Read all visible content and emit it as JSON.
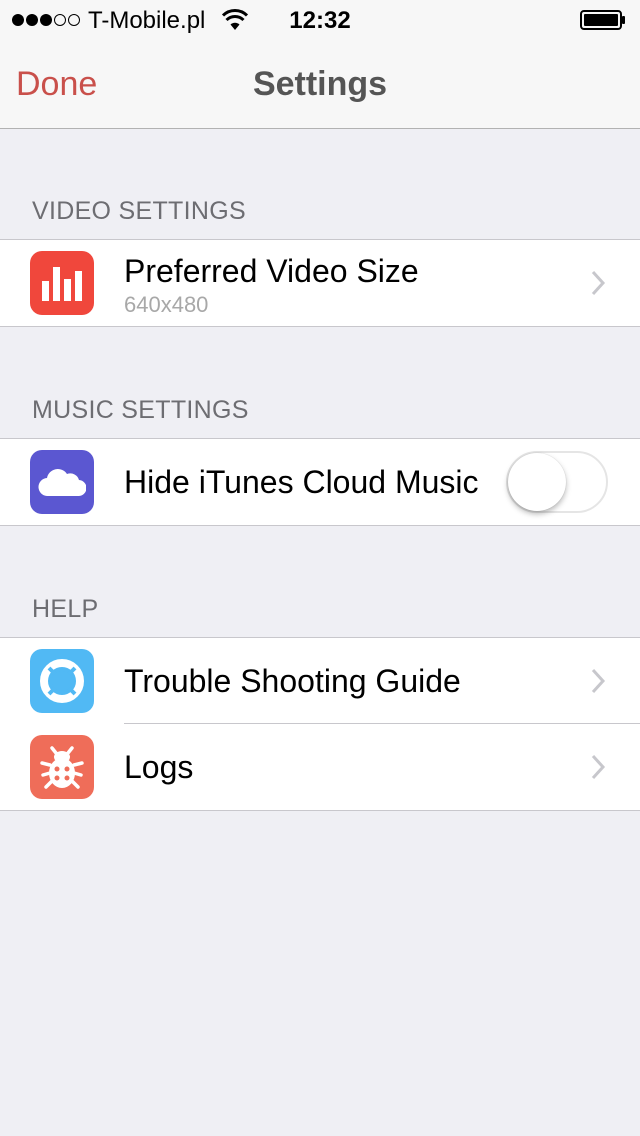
{
  "status_bar": {
    "signal_dots": [
      true,
      true,
      true,
      false,
      false
    ],
    "carrier": "T-Mobile.pl",
    "wifi_icon": "wifi-icon",
    "time": "12:32",
    "battery_icon": "battery-full-icon"
  },
  "nav": {
    "done_label": "Done",
    "title": "Settings",
    "accent_color": "#c9504b"
  },
  "sections": {
    "video": {
      "header": "VIDEO SETTINGS",
      "rows": [
        {
          "label": "Preferred Video Size",
          "value": "640x480",
          "icon": "bar-chart-icon",
          "icon_color": "#f0473c"
        }
      ]
    },
    "music": {
      "header": "MUSIC SETTINGS",
      "rows": [
        {
          "label": "Hide iTunes Cloud Music",
          "icon": "cloud-icon",
          "icon_color": "#5b57d1",
          "toggle_on": false
        }
      ]
    },
    "help": {
      "header": "HELP",
      "rows": [
        {
          "label": "Trouble Shooting Guide",
          "icon": "lifebuoy-icon",
          "icon_color": "#51b9f4"
        },
        {
          "label": "Logs",
          "icon": "bug-icon",
          "icon_color": "#ef6d59"
        }
      ]
    }
  }
}
